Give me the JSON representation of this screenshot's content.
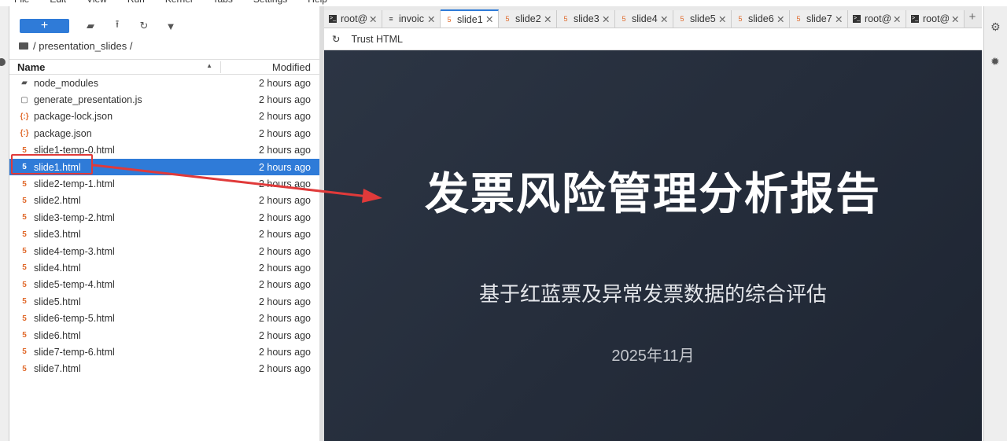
{
  "menu": [
    "File",
    "Edit",
    "View",
    "Run",
    "Kernel",
    "Tabs",
    "Settings",
    "Help"
  ],
  "toolbar": {
    "new_label": "+"
  },
  "breadcrumb": "/ presentation_slides /",
  "columns": {
    "name": "Name",
    "modified": "Modified"
  },
  "files": [
    {
      "name": "node_modules",
      "modified": "2 hours ago",
      "type": "folder"
    },
    {
      "name": "generate_presentation.js",
      "modified": "2 hours ago",
      "type": "file"
    },
    {
      "name": "package-lock.json",
      "modified": "2 hours ago",
      "type": "json"
    },
    {
      "name": "package.json",
      "modified": "2 hours ago",
      "type": "json"
    },
    {
      "name": "slide1-temp-0.html",
      "modified": "2 hours ago",
      "type": "html"
    },
    {
      "name": "slide1.html",
      "modified": "2 hours ago",
      "type": "html",
      "selected": true
    },
    {
      "name": "slide2-temp-1.html",
      "modified": "2 hours ago",
      "type": "html"
    },
    {
      "name": "slide2.html",
      "modified": "2 hours ago",
      "type": "html"
    },
    {
      "name": "slide3-temp-2.html",
      "modified": "2 hours ago",
      "type": "html"
    },
    {
      "name": "slide3.html",
      "modified": "2 hours ago",
      "type": "html"
    },
    {
      "name": "slide4-temp-3.html",
      "modified": "2 hours ago",
      "type": "html"
    },
    {
      "name": "slide4.html",
      "modified": "2 hours ago",
      "type": "html"
    },
    {
      "name": "slide5-temp-4.html",
      "modified": "2 hours ago",
      "type": "html"
    },
    {
      "name": "slide5.html",
      "modified": "2 hours ago",
      "type": "html"
    },
    {
      "name": "slide6-temp-5.html",
      "modified": "2 hours ago",
      "type": "html"
    },
    {
      "name": "slide6.html",
      "modified": "2 hours ago",
      "type": "html"
    },
    {
      "name": "slide7-temp-6.html",
      "modified": "2 hours ago",
      "type": "html"
    },
    {
      "name": "slide7.html",
      "modified": "2 hours ago",
      "type": "html"
    }
  ],
  "tabs": [
    {
      "label": "root@",
      "type": "terminal"
    },
    {
      "label": "invoic",
      "type": "text"
    },
    {
      "label": "slide1",
      "type": "html",
      "active": true
    },
    {
      "label": "slide2",
      "type": "html"
    },
    {
      "label": "slide3",
      "type": "html"
    },
    {
      "label": "slide4",
      "type": "html"
    },
    {
      "label": "slide5",
      "type": "html"
    },
    {
      "label": "slide6",
      "type": "html"
    },
    {
      "label": "slide7",
      "type": "html"
    },
    {
      "label": "root@",
      "type": "terminal"
    },
    {
      "label": "root@",
      "type": "terminal"
    }
  ],
  "viewer": {
    "trust_label": "Trust HTML"
  },
  "slide": {
    "title": "发票风险管理分析报告",
    "subtitle": "基于红蓝票及异常发票数据的综合评估",
    "date": "2025年11月"
  },
  "colors": {
    "accent": "#2f7bd8",
    "annotation": "#e03a3a",
    "slide_bg": "#262e3b"
  }
}
